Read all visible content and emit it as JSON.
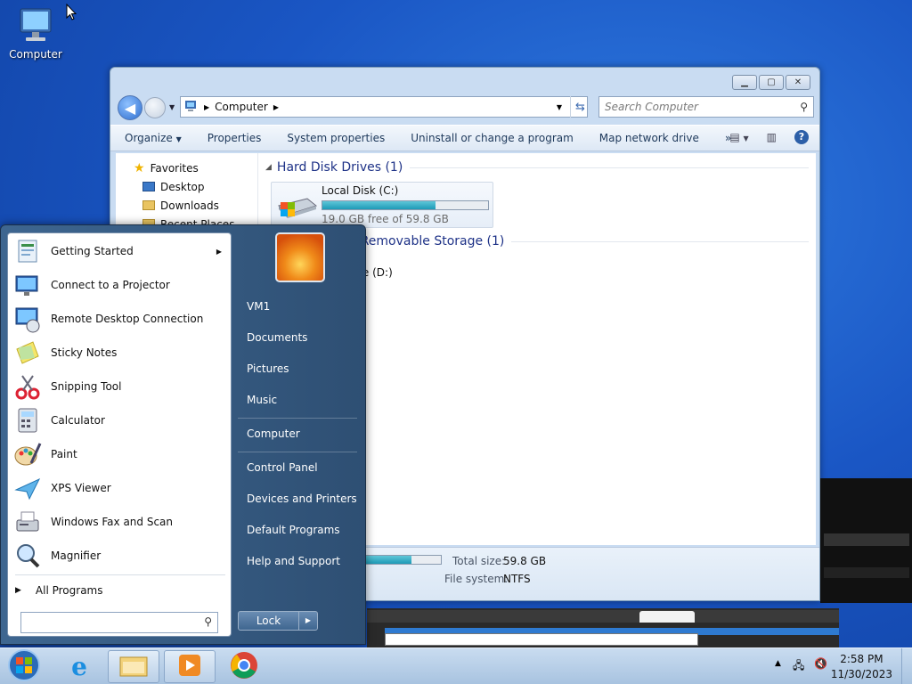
{
  "desktop": {
    "computer_icon_label": "Computer"
  },
  "explorer": {
    "address_segment": "Computer",
    "search_placeholder": "Search Computer",
    "commands": [
      "Organize",
      "Properties",
      "System properties",
      "Uninstall or change a program",
      "Map network drive",
      "»"
    ],
    "nav_pane": [
      {
        "label": "Favorites",
        "icon": "star-icon"
      },
      {
        "label": "Desktop",
        "icon": "desktop-folder-icon"
      },
      {
        "label": "Downloads",
        "icon": "downloads-folder-icon"
      },
      {
        "label": "Recent Places",
        "icon": "recent-places-icon"
      }
    ],
    "group_hdd": "Hard Disk Drives (1)",
    "drive_c": {
      "name": "Local Disk (C:)",
      "free_text": "19.0 GB free of 59.8 GB",
      "used_fraction": 0.682
    },
    "group_removable": "Devices with Removable Storage (1)",
    "drive_d_label": "DVD Drive (D:)",
    "details": {
      "total_label": "Total size:",
      "total_value": "59.8 GB",
      "fs_label": "File system:",
      "fs_value": "NTFS",
      "used_fraction": 0.682
    }
  },
  "start_menu": {
    "programs": [
      {
        "label": "Getting Started",
        "icon": "getting-started-icon",
        "has_arrow": true
      },
      {
        "label": "Connect to a Projector",
        "icon": "projector-icon"
      },
      {
        "label": "Remote Desktop Connection",
        "icon": "remote-desktop-icon"
      },
      {
        "label": "Sticky Notes",
        "icon": "sticky-notes-icon"
      },
      {
        "label": "Snipping Tool",
        "icon": "snipping-tool-icon"
      },
      {
        "label": "Calculator",
        "icon": "calculator-icon"
      },
      {
        "label": "Paint",
        "icon": "paint-icon"
      },
      {
        "label": "XPS Viewer",
        "icon": "xps-viewer-icon"
      },
      {
        "label": "Windows Fax and Scan",
        "icon": "fax-scan-icon"
      },
      {
        "label": "Magnifier",
        "icon": "magnifier-icon"
      }
    ],
    "all_programs": "All Programs",
    "right_links": [
      "VM1",
      "Documents",
      "Pictures",
      "Music",
      "Computer",
      "Control Panel",
      "Devices and Printers",
      "Default Programs",
      "Help and Support"
    ],
    "lock_label": "Lock"
  },
  "taskbar": {
    "time": "2:58 PM",
    "date": "11/30/2023",
    "pinned": [
      "start-orb",
      "internet-explorer",
      "windows-explorer",
      "media-player",
      "chrome"
    ]
  }
}
